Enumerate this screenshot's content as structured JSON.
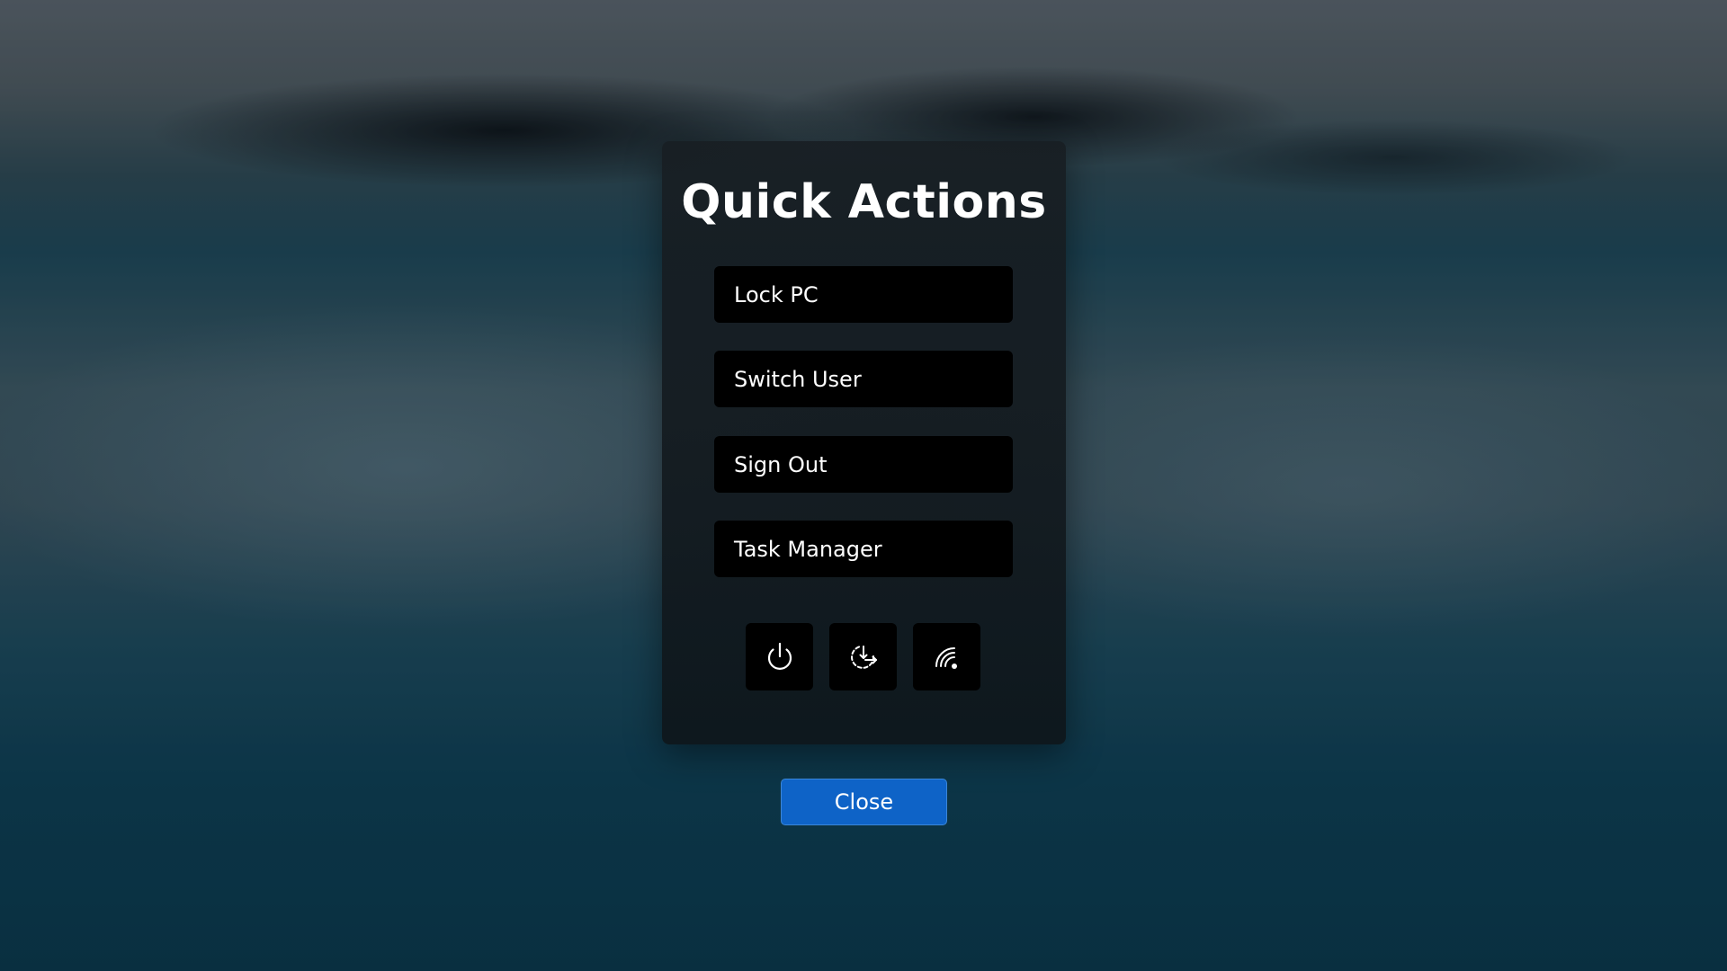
{
  "dialog": {
    "title": "Quick Actions",
    "actions": [
      {
        "label": "Lock PC"
      },
      {
        "label": "Switch User"
      },
      {
        "label": "Sign Out"
      },
      {
        "label": "Task Manager"
      }
    ],
    "icon_buttons": [
      {
        "icon": "power-icon"
      },
      {
        "icon": "restart-icon"
      },
      {
        "icon": "wifi-icon"
      }
    ],
    "close_label": "Close"
  },
  "colors": {
    "panel_bg": "#181e23",
    "button_bg": "#000000",
    "accent": "#0e63c7",
    "text": "#ffffff"
  }
}
